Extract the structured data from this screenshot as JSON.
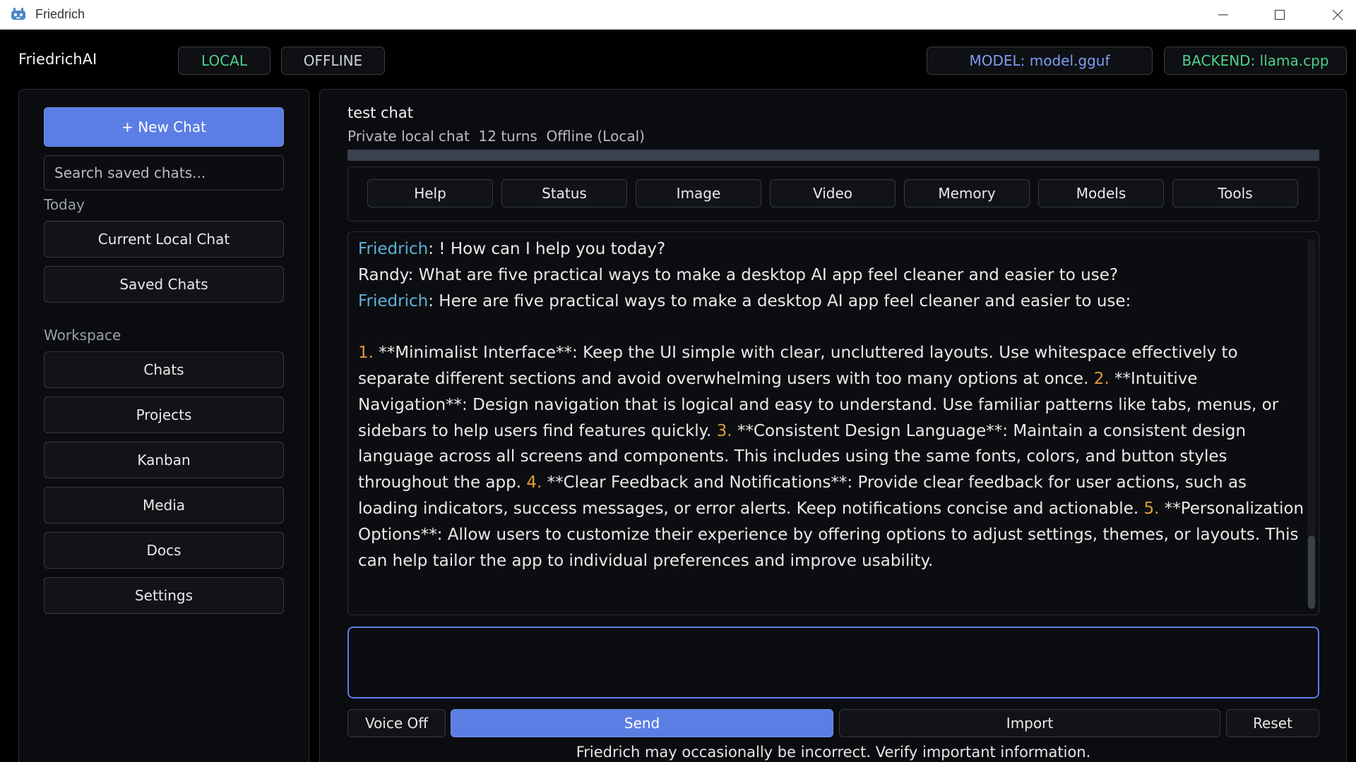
{
  "window": {
    "title": "Friedrich"
  },
  "header": {
    "brand": "FriedrichAI",
    "badges": {
      "local": "LOCAL",
      "offline": "OFFLINE"
    },
    "model": "MODEL: model.gguf",
    "backend": "BACKEND: llama.cpp"
  },
  "colors": {
    "accent": "#5b7ee5",
    "green": "#4fd18b",
    "speaker": "#5fb0d8",
    "numbering": "#e09a3a",
    "model_text": "#7f9cf0"
  },
  "sidebar": {
    "new_chat": "+  New Chat",
    "search_placeholder": "Search saved chats...",
    "today_label": "Today",
    "today_items": [
      "Current Local Chat",
      "Saved Chats"
    ],
    "workspace_label": "Workspace",
    "workspace_items": [
      "Chats",
      "Projects",
      "Kanban",
      "Media",
      "Docs",
      "Settings"
    ]
  },
  "chat": {
    "title": "test chat",
    "meta": "Private local chat  12 turns  Offline (Local)",
    "tabs": [
      "Help",
      "Status",
      "Image",
      "Video",
      "Memory",
      "Models",
      "Tools"
    ],
    "messages": [
      {
        "speaker": "Friedrich",
        "text": ": ! How can I help you today?"
      },
      {
        "text": "Randy: What are five practical ways to make a desktop AI app feel cleaner and easier to use?"
      },
      {
        "speaker": "Friedrich",
        "text": ": Here are five practical ways to make a desktop AI app feel cleaner and easier to use:"
      }
    ],
    "list": [
      {
        "num": "1.",
        "text": " **Minimalist Interface**: Keep the UI simple with clear, uncluttered layouts. Use whitespace effectively to separate different sections and avoid overwhelming users with too many options at once. "
      },
      {
        "num": "2.",
        "text": " **Intuitive Navigation**: Design navigation that is logical and easy to understand. Use familiar patterns like tabs, menus, or sidebars to help users find features quickly. "
      },
      {
        "num": "3.",
        "text": " **Consistent Design Language**: Maintain a consistent design language across all screens and components. This includes using the same fonts, colors, and button styles throughout the app. "
      },
      {
        "num": "4.",
        "text": " **Clear Feedback and Notifications**: Provide clear feedback for user actions, such as loading indicators, success messages, or error alerts. Keep notifications concise and actionable. "
      },
      {
        "num": "5.",
        "text": " **Personalization Options**: Allow users to customize their experience by offering options to adjust settings, themes, or layouts. This can help tailor the app to individual preferences and improve usability."
      }
    ]
  },
  "composer": {
    "value": "",
    "voice": "Voice Off",
    "send": "Send",
    "import": "Import",
    "reset": "Reset"
  },
  "footer": "Friedrich may occasionally be incorrect. Verify important information."
}
